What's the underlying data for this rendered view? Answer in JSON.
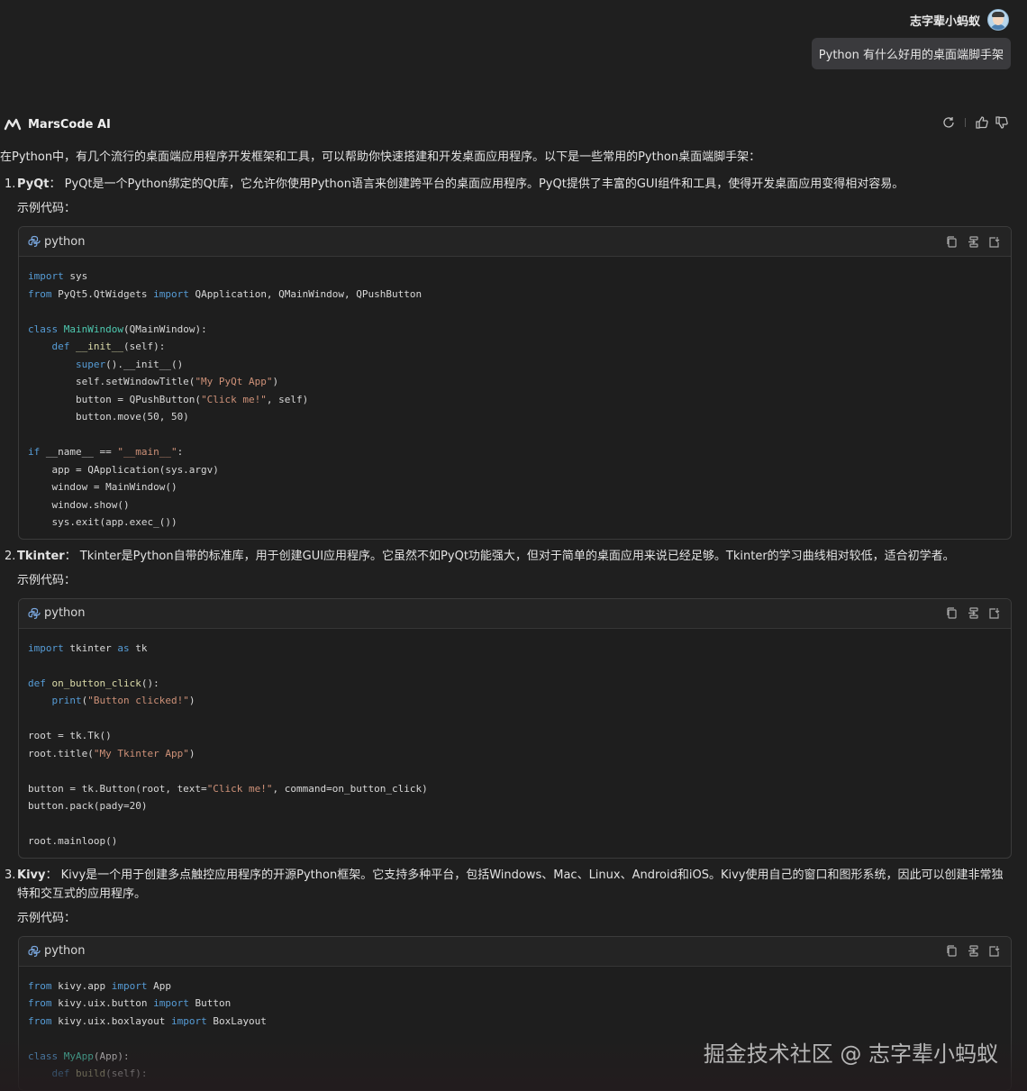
{
  "user": {
    "name": "志字辈小蚂蚁",
    "question": "Python 有什么好用的桌面端脚手架"
  },
  "ai": {
    "name": "MarsCode AI",
    "intro": "在Python中，有几个流行的桌面端应用程序开发框架和工具，可以帮助你快速搭建和开发桌面应用程序。以下是一些常用的Python桌面端脚手架："
  },
  "items": [
    {
      "num": "1.",
      "title": "PyQt",
      "desc": "：  PyQt是一个Python绑定的Qt库，它允许你使用Python语言来创建跨平台的桌面应用程序。PyQt提供了丰富的GUI组件和工具，使得开发桌面应用变得相对容易。",
      "example_label": "示例代码：",
      "lang": "python",
      "code": [
        "import sys",
        "from PyQt5.QtWidgets import QApplication, QMainWindow, QPushButton",
        "",
        "class MainWindow(QMainWindow):",
        "    def __init__(self):",
        "        super().__init__()",
        "        self.setWindowTitle(\"My PyQt App\")",
        "        button = QPushButton(\"Click me!\", self)",
        "        button.move(50, 50)",
        "",
        "if __name__ == \"__main__\":",
        "    app = QApplication(sys.argv)",
        "    window = MainWindow()",
        "    window.show()",
        "    sys.exit(app.exec_())"
      ]
    },
    {
      "num": "2.",
      "title": "Tkinter",
      "desc": "：  Tkinter是Python自带的标准库，用于创建GUI应用程序。它虽然不如PyQt功能强大，但对于简单的桌面应用来说已经足够。Tkinter的学习曲线相对较低，适合初学者。",
      "example_label": "示例代码：",
      "lang": "python",
      "code": [
        "import tkinter as tk",
        "",
        "def on_button_click():",
        "    print(\"Button clicked!\")",
        "",
        "root = tk.Tk()",
        "root.title(\"My Tkinter App\")",
        "",
        "button = tk.Button(root, text=\"Click me!\", command=on_button_click)",
        "button.pack(pady=20)",
        "",
        "root.mainloop()"
      ]
    },
    {
      "num": "3.",
      "title": "Kivy",
      "desc": "：  Kivy是一个用于创建多点触控应用程序的开源Python框架。它支持多种平台，包括Windows、Mac、Linux、Android和iOS。Kivy使用自己的窗口和图形系统，因此可以创建非常独特和交互式的应用程序。",
      "example_label": "示例代码：",
      "lang": "python",
      "code": [
        "from kivy.app import App",
        "from kivy.uix.button import Button",
        "from kivy.uix.boxlayout import BoxLayout",
        "",
        "class MyApp(App):",
        "    def build(self):"
      ]
    }
  ],
  "watermark": "掘金技术社区 @ 志字辈小蚂蚁",
  "icons": {
    "regenerate": "refresh-icon",
    "like": "thumbs-up-icon",
    "dislike": "thumbs-down-icon",
    "copy": "copy-icon",
    "insert": "insert-icon",
    "apply": "apply-icon",
    "python": "python-icon"
  }
}
